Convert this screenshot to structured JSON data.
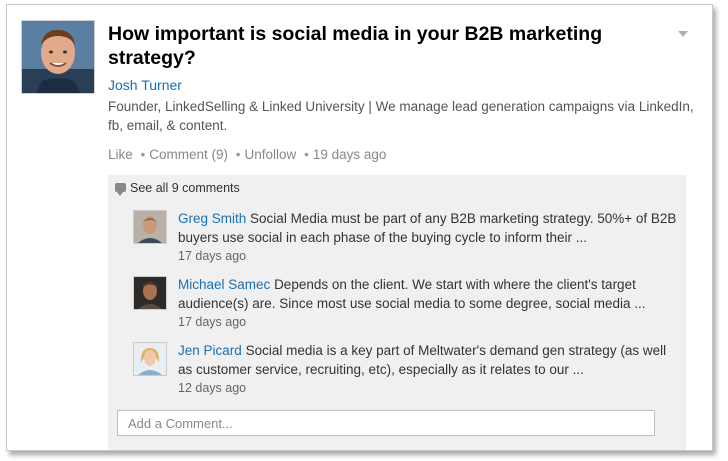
{
  "post": {
    "title": "How important is social media in your B2B marketing strategy?",
    "author": "Josh Turner",
    "headline": "Founder, LinkedSelling & Linked University | We manage lead generation campaigns via LinkedIn, fb, email, & content.",
    "actions": {
      "like": "Like",
      "comment": "Comment (9)",
      "unfollow": "Unfollow",
      "time": "19 days ago"
    }
  },
  "comments": {
    "see_all": "See all 9 comments",
    "items": [
      {
        "name": "Greg Smith",
        "text": "Social Media must be part of any B2B marketing strategy. 50%+ of B2B buyers use social in each phase of the buying cycle to inform their ...",
        "time": "17 days ago"
      },
      {
        "name": "Michael Samec",
        "text": "Depends on the client. We start with where the client's target audience(s) are. Since most use social media to some degree, social media ...",
        "time": "17 days ago"
      },
      {
        "name": "Jen Picard",
        "text": "Social media is a key part of Meltwater's demand gen strategy (as well as customer service, recruiting, etc), especially as it relates to our ...",
        "time": "12 days ago"
      }
    ],
    "add_placeholder": "Add a Comment..."
  },
  "colors": {
    "link": "#1a6fb5",
    "comment_bg": "#f0f0f0"
  },
  "icons": [
    "speech-bubble-icon",
    "dropdown-caret-icon"
  ]
}
